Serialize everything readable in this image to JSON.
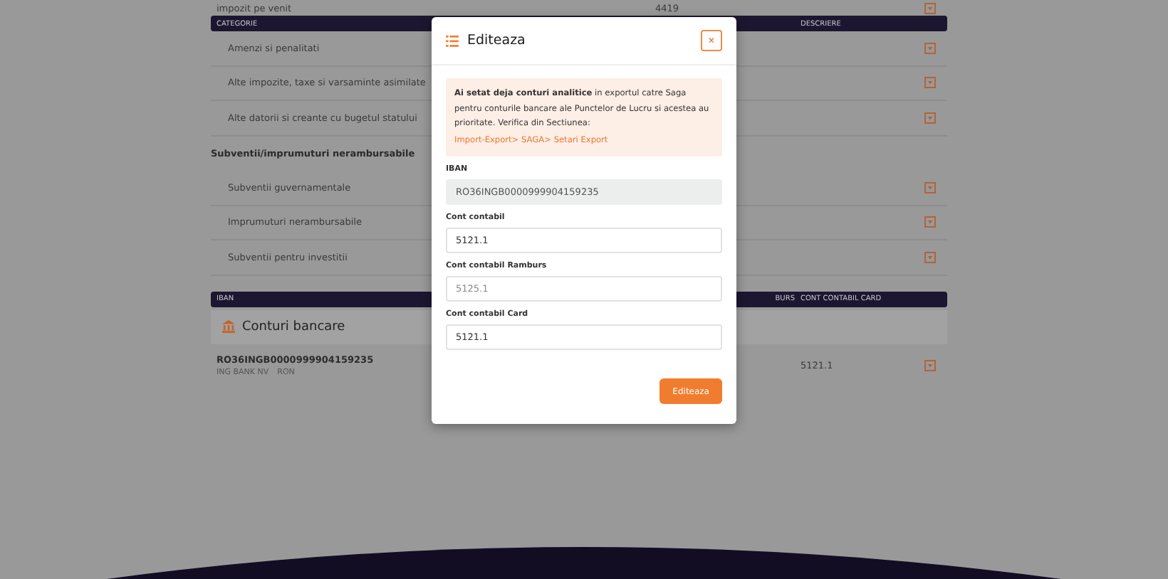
{
  "background_table": {
    "top_row": {
      "category": "impozit pe venit",
      "column_2": "4419"
    },
    "columns": [
      "CATEGORIE",
      "DESCRIERE"
    ],
    "rows": [
      {
        "kind": "item",
        "category": "Amenzi si penalitati"
      },
      {
        "kind": "item",
        "category": "Alte impozite, taxe si varsaminte asimilate"
      },
      {
        "kind": "item",
        "category": "Alte datorii si creante cu bugetul statului"
      },
      {
        "kind": "group",
        "category": "Subventii/imprumuturi nerambursabile"
      },
      {
        "kind": "item",
        "category": "Subventii guvernamentale"
      },
      {
        "kind": "item",
        "category": "Imprumuturi nerambursabile"
      },
      {
        "kind": "item",
        "category": "Subventii pentru investitii"
      }
    ]
  },
  "bank_table": {
    "columns": [
      "IBAN",
      "BURS",
      "CONT CONTABIL CARD"
    ],
    "section": "Conturi bancare",
    "rows": [
      {
        "iban": "RO36INGB0000999904159235",
        "bank": "ING BANK NV",
        "currency": "RON",
        "card_account": "5121.1"
      }
    ]
  },
  "modal": {
    "title": "Editeaza",
    "close": "×",
    "alert": "**Ai setat deja conturi analitice** in exportul catre Saga pentru conturile bancare ale Punctelor de Lucru si acestea au prioritate. Verifica din Sectiunea:",
    "alert_link": "Import-Export> SAGA> Setari Export",
    "fields": [
      {
        "label": "IBAN",
        "value": "RO36INGB0000999904159235",
        "disabled": true
      },
      {
        "label": "Cont contabil",
        "value": "5121.1",
        "disabled": false
      },
      {
        "label": "Cont contabil Ramburs",
        "placeholder": "5125.1",
        "disabled": false
      },
      {
        "label": "Cont contabil Card",
        "value": "5121.1",
        "disabled": false
      }
    ],
    "submit": "Editeaza"
  }
}
